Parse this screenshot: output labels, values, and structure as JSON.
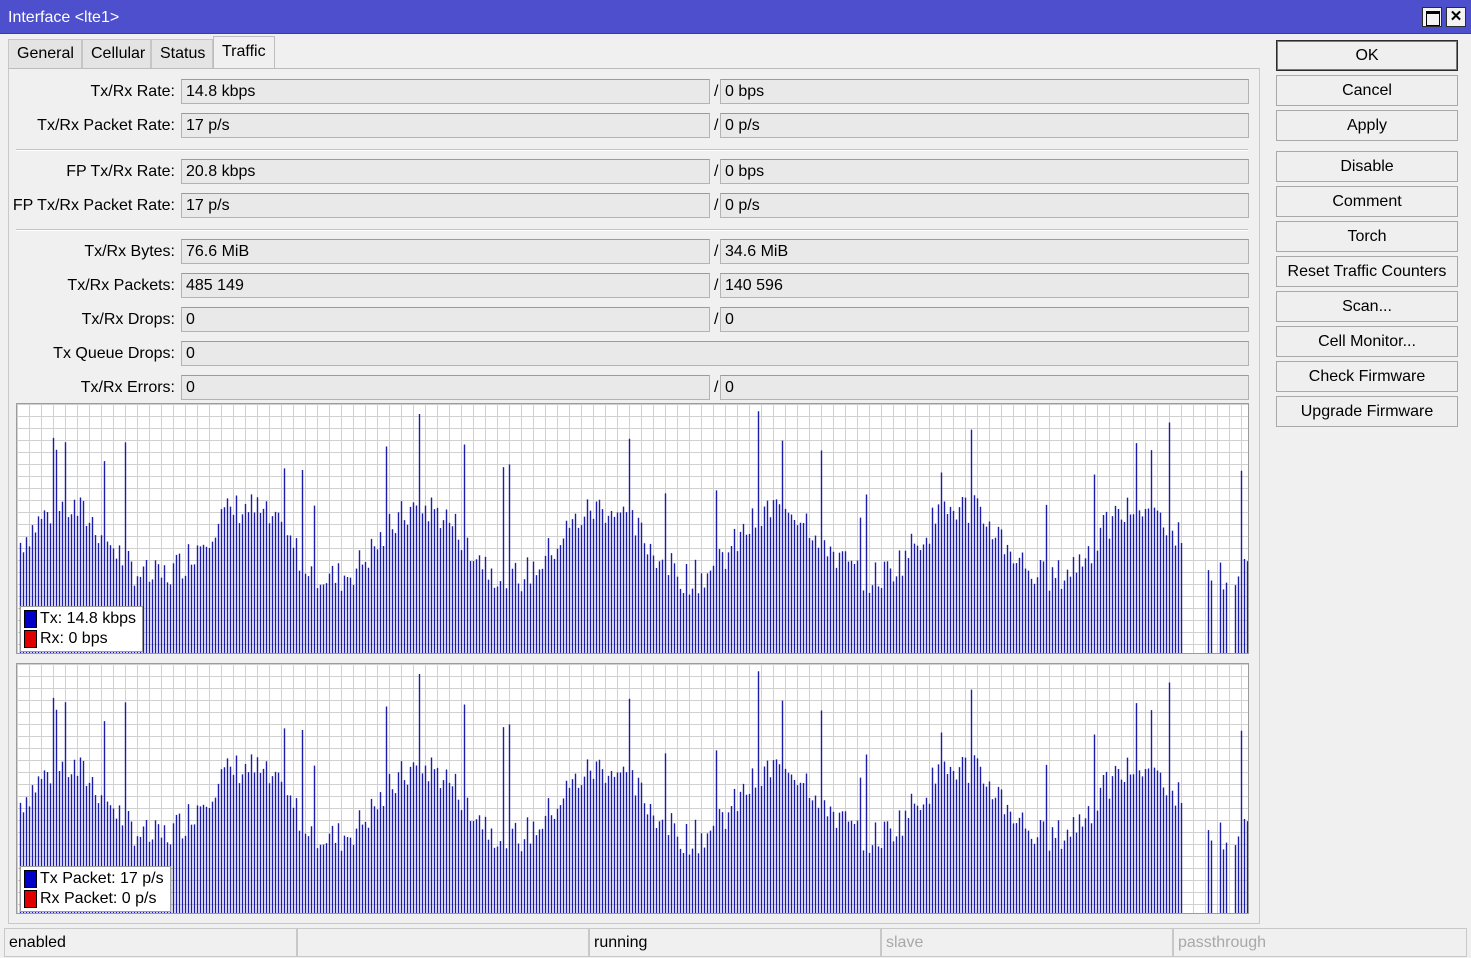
{
  "window": {
    "title": "Interface <lte1>",
    "maximize_icon": "maximize-icon",
    "close_icon": "close-icon",
    "close_glyph": "✕"
  },
  "tabs": [
    {
      "label": "General",
      "active": false
    },
    {
      "label": "Cellular",
      "active": false
    },
    {
      "label": "Status",
      "active": false
    },
    {
      "label": "Traffic",
      "active": true
    }
  ],
  "fields": {
    "txrx_rate": {
      "label": "Tx/Rx Rate:",
      "tx": "14.8 kbps",
      "rx": "0 bps"
    },
    "txrx_packet_rate": {
      "label": "Tx/Rx Packet Rate:",
      "tx": "17 p/s",
      "rx": "0 p/s"
    },
    "fp_txrx_rate": {
      "label": "FP Tx/Rx Rate:",
      "tx": "20.8 kbps",
      "rx": "0 bps"
    },
    "fp_txrx_packet_rate": {
      "label": "FP Tx/Rx Packet Rate:",
      "tx": "17 p/s",
      "rx": "0 p/s"
    },
    "txrx_bytes": {
      "label": "Tx/Rx Bytes:",
      "tx": "76.6 MiB",
      "rx": "34.6 MiB"
    },
    "txrx_packets": {
      "label": "Tx/Rx Packets:",
      "tx": "485 149",
      "rx": "140 596"
    },
    "txrx_drops": {
      "label": "Tx/Rx Drops:",
      "tx": "0",
      "rx": "0"
    },
    "tx_queue_drops": {
      "label": "Tx Queue Drops:",
      "value": "0"
    },
    "txrx_errors": {
      "label": "Tx/Rx Errors:",
      "tx": "0",
      "rx": "0"
    },
    "slash": "/"
  },
  "graphs": {
    "rate": {
      "legend_tx": "Tx:  14.8 kbps",
      "legend_rx": "Rx:  0 bps",
      "tx_color": "#0000c8",
      "rx_color": "#e00000"
    },
    "packet": {
      "legend_tx": "Tx Packet:  17 p/s",
      "legend_rx": "Rx Packet:  0 p/s",
      "tx_color": "#0000c8",
      "rx_color": "#e00000"
    },
    "bar_color": "#1c1caa",
    "grid_color": "#d0d0d0"
  },
  "buttons": {
    "ok": "OK",
    "cancel": "Cancel",
    "apply": "Apply",
    "disable": "Disable",
    "comment": "Comment",
    "torch": "Torch",
    "reset_traffic_counters": "Reset Traffic Counters",
    "scan": "Scan...",
    "cell_monitor": "Cell Monitor...",
    "check_firmware": "Check Firmware",
    "upgrade_firmware": "Upgrade Firmware"
  },
  "status_bar": {
    "state": "enabled",
    "blank": "",
    "running": "running",
    "slave": "slave",
    "passthrough": "passthrough"
  }
}
